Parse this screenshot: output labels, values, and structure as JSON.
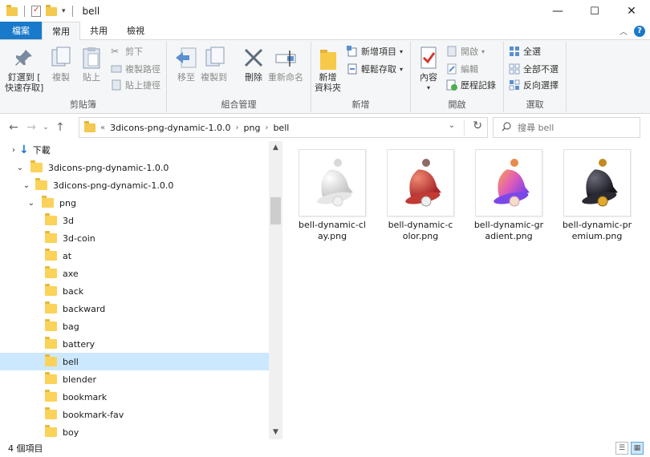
{
  "window": {
    "title": "bell",
    "minimize": "—",
    "maximize": "☐",
    "close": "✕"
  },
  "ribbon_tabs": [
    {
      "label": "檔案"
    },
    {
      "label": "常用"
    },
    {
      "label": "共用"
    },
    {
      "label": "檢視"
    }
  ],
  "ribbon": {
    "clipboard": {
      "pin_label_1": "釘選到 [",
      "pin_label_2": "快速存取]",
      "copy": "複製",
      "paste": "貼上",
      "cut": "剪下",
      "copy_path": "複製路徑",
      "paste_shortcut": "貼上捷徑",
      "group_label": "剪貼簿"
    },
    "organize": {
      "move_to": "移至",
      "copy_to": "複製到",
      "delete": "刪除",
      "rename": "重新命名",
      "group_label": "組合管理"
    },
    "new": {
      "new_folder_1": "新增",
      "new_folder_2": "資料夾",
      "new_item": "新增項目",
      "easy_access": "輕鬆存取",
      "group_label": "新增"
    },
    "open": {
      "properties": "內容",
      "open": "開啟",
      "edit": "編輯",
      "history": "歷程記錄",
      "group_label": "開啟"
    },
    "select": {
      "select_all": "全選",
      "select_none": "全部不選",
      "invert": "反向選擇",
      "group_label": "選取"
    }
  },
  "address": {
    "overflow": "«",
    "crumbs": [
      "3dicons-png-dynamic-1.0.0",
      "png",
      "bell"
    ],
    "search_placeholder": "搜尋 bell"
  },
  "nav_tree": {
    "downloads": "下載",
    "root": "3dicons-png-dynamic-1.0.0",
    "sub": "3dicons-png-dynamic-1.0.0",
    "png": "png",
    "folders": [
      "3d",
      "3d-coin",
      "at",
      "axe",
      "back",
      "backward",
      "bag",
      "battery",
      "bell",
      "blender",
      "bookmark",
      "bookmark-fav",
      "boy"
    ],
    "selected": "bell"
  },
  "files": [
    {
      "name_line1": "bell-dynamic-cl",
      "name_line2": "ay.png",
      "variant": "clay",
      "colors": [
        "#f2f2f2",
        "#c9c9c9"
      ]
    },
    {
      "name_line1": "bell-dynamic-c",
      "name_line2": "olor.png",
      "variant": "color",
      "colors": [
        "#e05a4c",
        "#b52a2a"
      ]
    },
    {
      "name_line1": "bell-dynamic-gr",
      "name_line2": "adient.png",
      "variant": "gradient",
      "colors": [
        "#f5a04b",
        "#7b3cf0"
      ]
    },
    {
      "name_line1": "bell-dynamic-pr",
      "name_line2": "emium.png",
      "variant": "premium",
      "colors": [
        "#4a4a55",
        "#1c1c24"
      ]
    }
  ],
  "status": {
    "count": "4 個項目"
  }
}
